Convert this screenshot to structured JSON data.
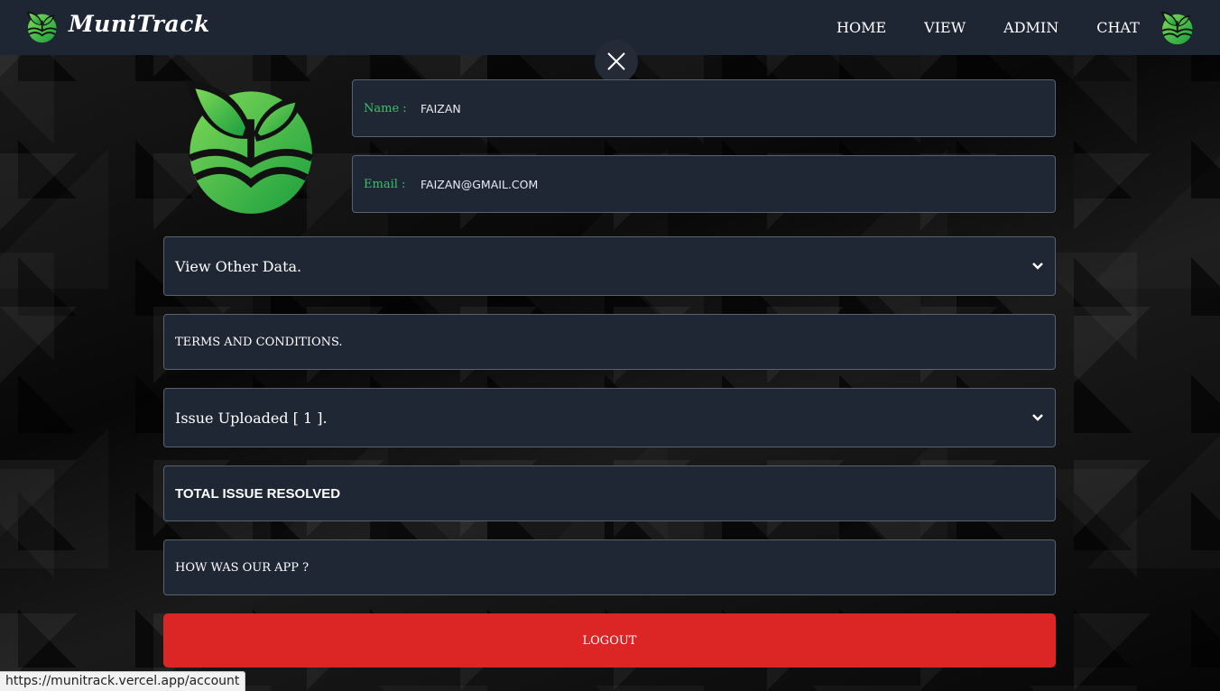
{
  "nav": {
    "brand": "MuniTrack",
    "links": [
      "HOME",
      "VIEW",
      "ADMIN",
      "CHAT"
    ]
  },
  "profile": {
    "name_label": "Name :",
    "name_value": "FAIZAN",
    "email_label": "Email :",
    "email_value": "FAIZAN@GMAIL.COM"
  },
  "panels": {
    "other_data": "View Other Data.",
    "terms": "TERMS AND CONDITIONS.",
    "issues_uploaded": "Issue Uploaded [ 1 ].",
    "total_resolved": "TOTAL ISSUE RESOLVED",
    "feedback": "HOW WAS OUR APP ?"
  },
  "logout_label": "LOGOUT",
  "status_url": "https://munitrack.vercel.app/account",
  "colors": {
    "navbar": "#1e2533",
    "panel": "#1f2735",
    "accent_green": "#3fbf6a",
    "logout_red": "#dc2626"
  },
  "icons": [
    "leaf-logo-icon",
    "close-icon",
    "chevron-down-icon"
  ]
}
